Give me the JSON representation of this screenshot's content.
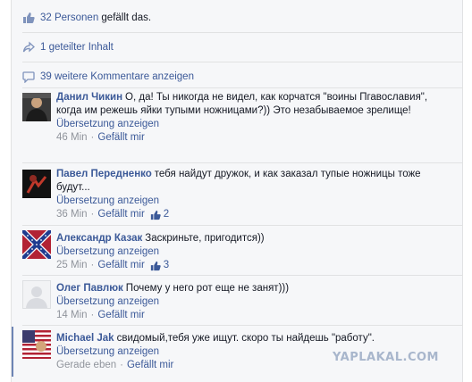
{
  "likes_row": {
    "count_link": "32 Personen",
    "suffix": " gefällt das."
  },
  "shares_row": {
    "label": "1 geteilter Inhalt"
  },
  "more_comments": {
    "label": "39 weitere Kommentare anzeigen"
  },
  "actions": {
    "translate": "Übersetzung anzeigen",
    "like": "Gefällt mir",
    "separator": "·"
  },
  "comments": [
    {
      "author": "Данил Чикин",
      "text": "О, да! Ты никогда не видел, как корчатся \"воины Пгавославия\", когда им режешь яйки тупыми ножницами?)) Это незабываемое зрелище!",
      "time": "46 Min",
      "likes": ""
    },
    {
      "author": "Павел Передненко",
      "text": "тебя найдут дружок, и как заказал тупые ножницы тоже будут...",
      "time": "36 Min",
      "likes": "2"
    },
    {
      "author": "Александр Казак",
      "text": "Заскриньте, пригодится))",
      "time": "25 Min",
      "likes": "3"
    },
    {
      "author": "Олег Павлюк",
      "text": "Почему у него рот еще не занят)))",
      "time": "14 Min",
      "likes": ""
    },
    {
      "author": "Michael Jak",
      "text": "свидомый,тебя уже ищут. скоро ты найдешь \"работу\".",
      "time": "Gerade eben",
      "likes": ""
    }
  ],
  "watermark": "YAPLAKAL.COM",
  "colors": {
    "link": "#3b5998",
    "meta": "#90949c",
    "panel": "#f6f7f9",
    "highlight": "#6d84b4"
  }
}
